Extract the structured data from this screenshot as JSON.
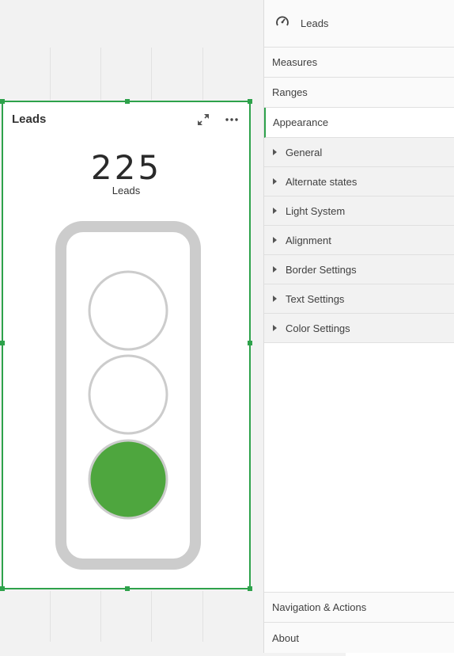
{
  "visualization": {
    "title": "Leads",
    "kpi_value": "225",
    "kpi_label": "Leads",
    "active_light": "bottom",
    "active_color": "#4ea63e",
    "inactive_fill": "#ffffff",
    "frame_color": "#cccccc",
    "selection_color": "#2ea24b",
    "icons": [
      "expand-icon",
      "more-options-icon"
    ]
  },
  "panel": {
    "header_label": "Leads",
    "header_icon": "gauge-icon",
    "sections": {
      "measures": "Measures",
      "ranges": "Ranges",
      "appearance": "Appearance"
    },
    "appearance_items": [
      "General",
      "Alternate states",
      "Light System",
      "Alignment",
      "Border Settings",
      "Text Settings",
      "Color Settings"
    ],
    "bottom": {
      "navigation": "Navigation & Actions",
      "about": "About"
    }
  }
}
